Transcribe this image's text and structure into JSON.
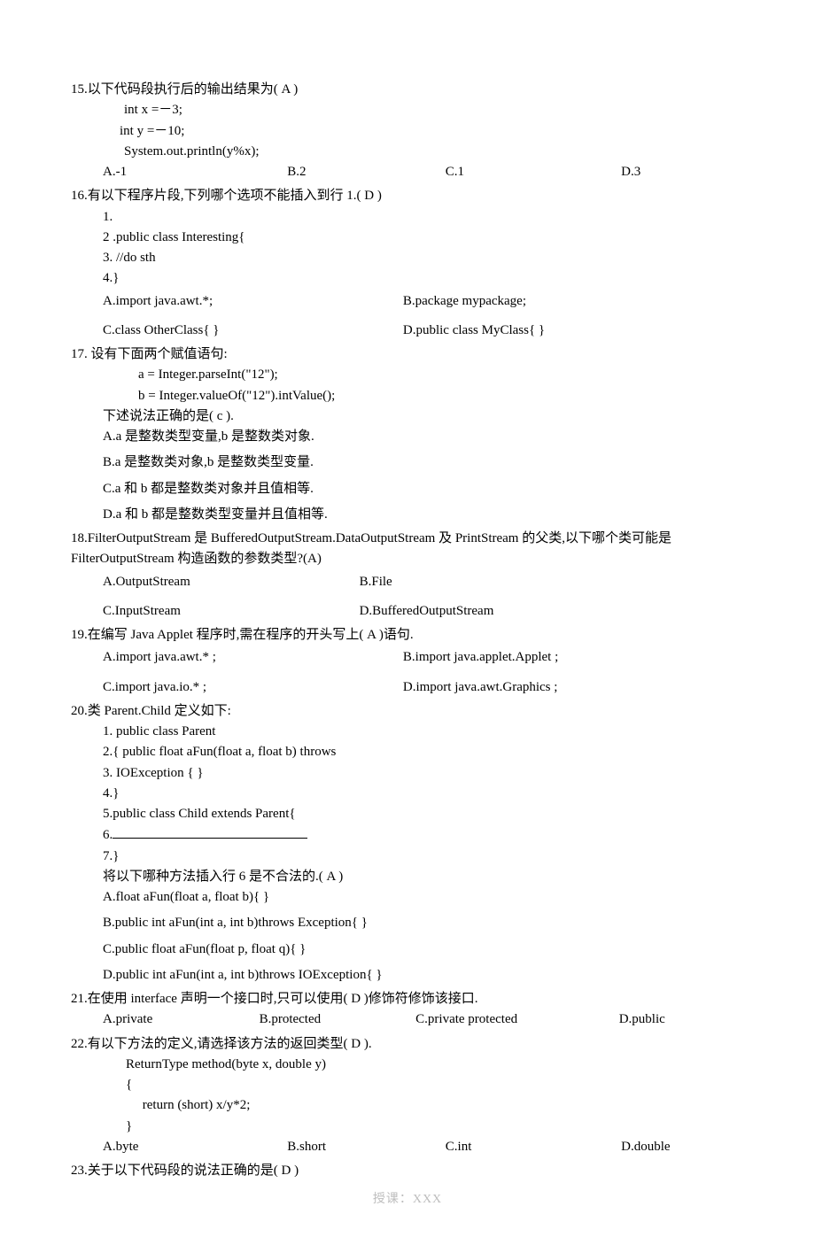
{
  "q15": {
    "head": "15.以下代码段执行后的输出结果为(   A   )",
    "code1": "int   x =－3;",
    "code2": "int   y =－10;",
    "code3": "System.out.println(y%x);",
    "a": "A.-1",
    "b": "B.2",
    "c": "C.1",
    "d": "D.3"
  },
  "q16": {
    "head": "16.有以下程序片段,下列哪个选项不能插入到行 1.(     D )",
    "l1": "1.",
    "l2": "2 .public   class    Interesting{",
    "l3": "3. //do sth",
    "l4": "4.}",
    "a": "A.import java.awt.*;",
    "b": "B.package mypackage;",
    "c": "C.class OtherClass{      }",
    "d": "D.public class MyClass{ }"
  },
  "q17": {
    "head": "17.  设有下面两个赋值语句:",
    "c1": "a = Integer.parseInt(\"12\");",
    "c2": "b = Integer.valueOf(\"12\").intValue();",
    "sub": "下述说法正确的是( c     ).",
    "a": "A.a 是整数类型变量,b 是整数类对象.",
    "b": "B.a 是整数类对象,b 是整数类型变量.",
    "cc": "C.a 和 b 都是整数类对象并且值相等.",
    "d": "D.a 和 b 都是整数类型变量并且值相等."
  },
  "q18": {
    "h1": "18.FilterOutputStream 是 BufferedOutputStream.DataOutputStream 及 PrintStream 的父类,以下哪个类可能是 FilterOutputStream 构造函数的参数类型?(A)",
    "a": "A.OutputStream",
    "b": "B.File",
    "c": "C.InputStream",
    "d": "D.BufferedOutputStream"
  },
  "q19": {
    "head": "19.在编写 Java   Applet 程序时,需在程序的开头写上(   A     )语句.",
    "a": "A.import   java.awt.* ;",
    "b": "B.import   java.applet.Applet ;",
    "c": "C.import   java.io.* ;",
    "d": "D.import   java.awt.Graphics ;"
  },
  "q20": {
    "head": "20.类 Parent.Child 定义如下:",
    "l1": "1.    public class   Parent",
    "l2": "2.{ public   float   aFun(float a, float b)   throws",
    "l3": "3.   IOException {          }",
    "l4": "4.}",
    "l5": "5.public   class   Child   extends   Parent{",
    "l6": "6.",
    "l7": "7.}",
    "sub": "将以下哪种方法插入行 6 是不合法的.(   A )",
    "a": "A.float   aFun(float   a,   float   b){ }",
    "b": "B.public   int   aFun(int a, int b)throws   Exception{ }",
    "c": "C.public   float   aFun(float   p,   float q){ }",
    "d": "D.public   int   aFun(int a,   int   b)throws IOException{ }"
  },
  "q21": {
    "head": "21.在使用 interface 声明一个接口时,只可以使用( D     )修饰符修饰该接口.",
    "a": "A.private",
    "b": "B.protected",
    "c": "C.private   protected",
    "d": "D.public"
  },
  "q22": {
    "head": "22.有以下方法的定义,请选择该方法的返回类型(   D   ).",
    "c1": "ReturnType   method(byte x, double y)",
    "c2": "{",
    "c3": "     return (short) x/y*2;",
    "c4": "}",
    "a": "A.byte",
    "b": "B.short",
    "c": "C.int",
    "d": "D.double"
  },
  "q23": {
    "head": "23.关于以下代码段的说法正确的是(        D           )"
  },
  "footer": "授课：XXX"
}
